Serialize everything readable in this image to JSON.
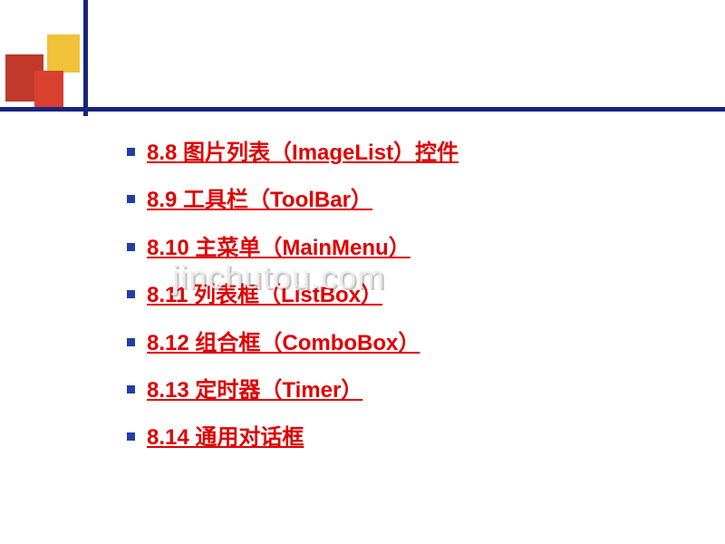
{
  "watermark": "jinchutou.com",
  "items": [
    {
      "label": "8.8 图片列表（ImageList）控件"
    },
    {
      "label": "8.9 工具栏（ToolBar）"
    },
    {
      "label": "8.10 主菜单（MainMenu）"
    },
    {
      "label": "8.11 列表框（ListBox）"
    },
    {
      "label": "8.12 组合框（ComboBox）"
    },
    {
      "label": "8.13 定时器（Timer）"
    },
    {
      "label": "8.14 通用对话框"
    }
  ]
}
